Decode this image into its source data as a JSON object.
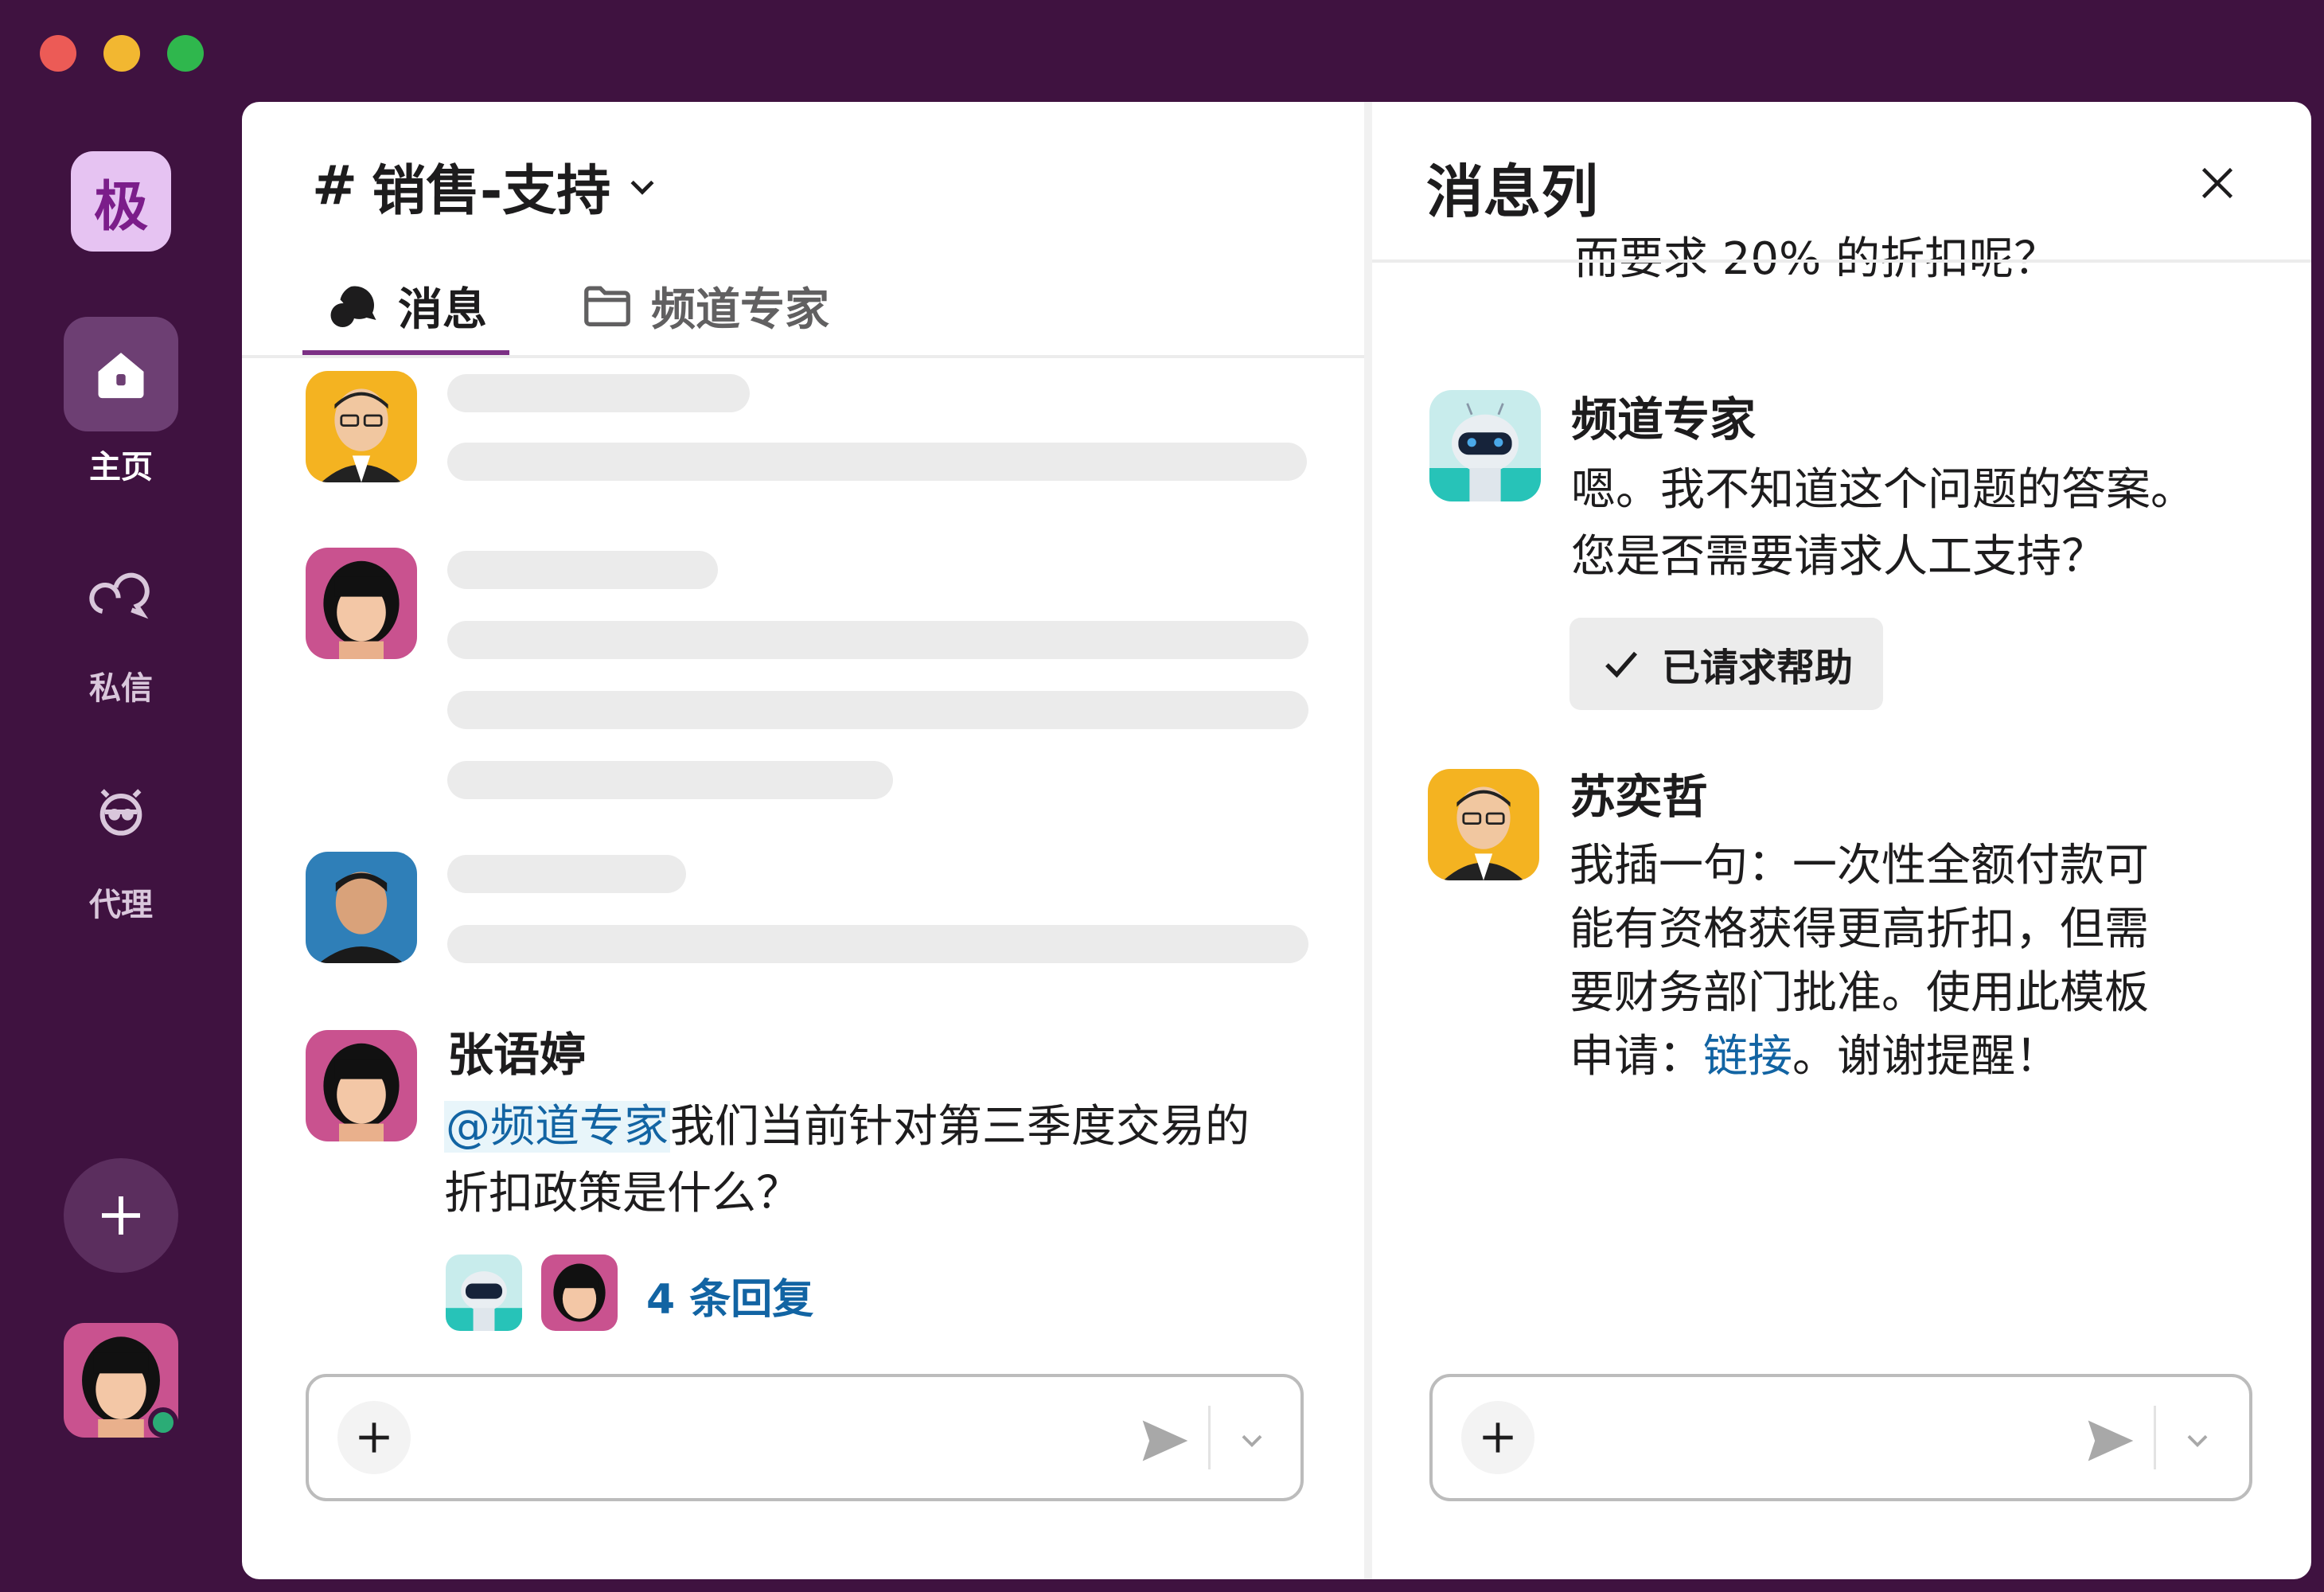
{
  "window_controls": {
    "close_color": "#ec5b56",
    "minimize_color": "#f2b731",
    "zoom_color": "#2fb74d"
  },
  "sidebar": {
    "workspace_initial": "极",
    "items": [
      {
        "label": "主页",
        "icon": "home-icon",
        "active": true
      },
      {
        "label": "私信",
        "icon": "dm-icon",
        "active": false
      },
      {
        "label": "代理",
        "icon": "agent-icon",
        "active": false
      }
    ],
    "add_icon": "plus-icon",
    "presence_color": "#2bac76"
  },
  "channel": {
    "hash": "#",
    "name": "销售-支持",
    "tabs": [
      {
        "label": "消息",
        "icon": "messages-icon",
        "active": true
      },
      {
        "label": "频道专家",
        "icon": "folder-icon",
        "active": false
      }
    ],
    "message": {
      "author": "张语婷",
      "mention": "@频道专家",
      "text_line1": "我们当前针对第三季度交易的",
      "text_line2": "折扣政策是什么？",
      "replies": "4 条回复"
    }
  },
  "thread": {
    "title": "消息列",
    "clipped_line": "而要求 20% 的折扣呢？",
    "messages": [
      {
        "author": "频道专家",
        "line1": "嗯。我不知道这个问题的答案。",
        "line2": "您是否需要请求人工支持？",
        "button": "已请求帮助"
      },
      {
        "author": "苏奕哲",
        "line1": "我插一句：一次性全额付款可",
        "line2": "能有资格获得更高折扣，但需",
        "line3": "要财务部门批准。使用此模板",
        "line4_prefix": "申请：",
        "line4_link": "链接",
        "line4_suffix": "。谢谢提醒！"
      }
    ]
  },
  "colors": {
    "sidebar_bg": "#3f1240",
    "accent": "#7c3085",
    "link": "#1264a3"
  }
}
